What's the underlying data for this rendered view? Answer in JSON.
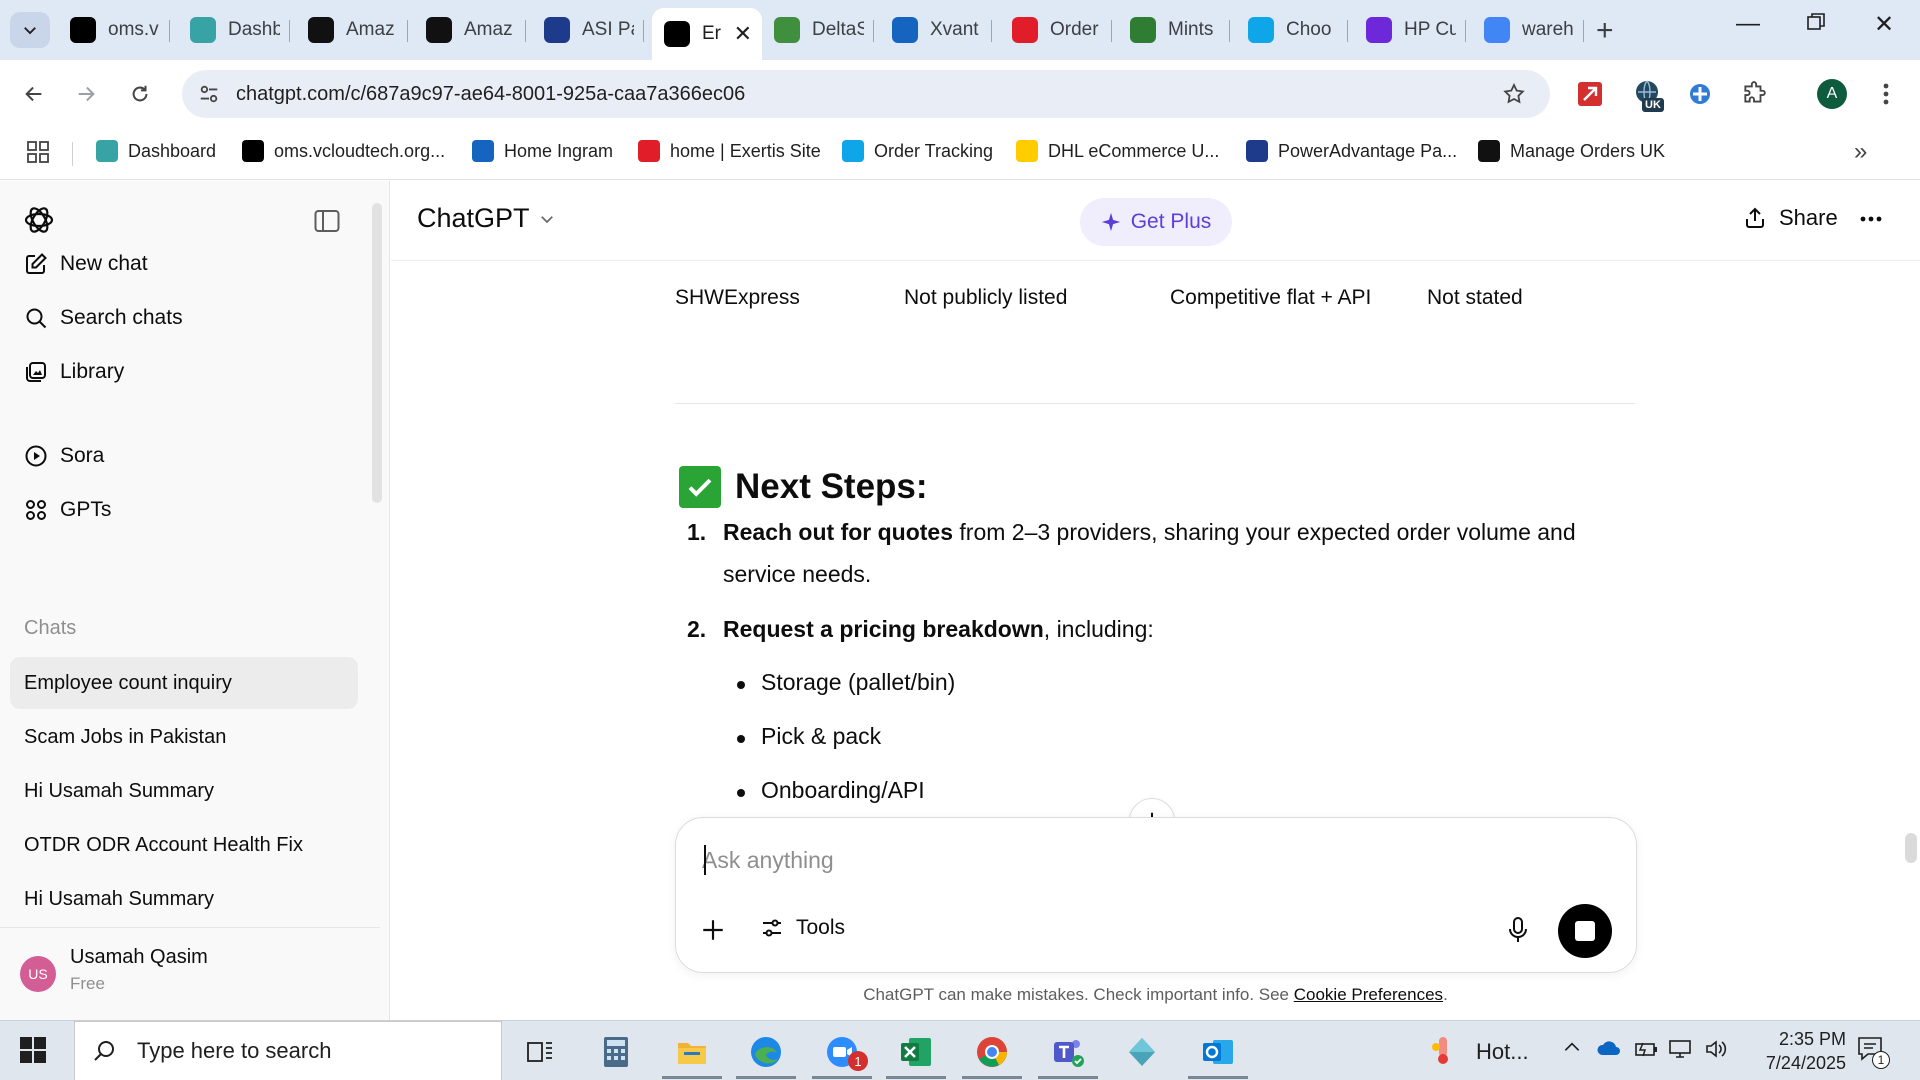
{
  "browser": {
    "tabs": [
      {
        "label": "oms.v",
        "icon": "vcloud-icon",
        "color": "#000000"
      },
      {
        "label": "Dashb",
        "icon": "dashboard-icon",
        "color": "#38a3a5"
      },
      {
        "label": "Amaz",
        "icon": "amazon-icon",
        "color": "#111111"
      },
      {
        "label": "Amaz",
        "icon": "amazon-icon",
        "color": "#111111"
      },
      {
        "label": "ASI Pa",
        "icon": "asi-icon",
        "color": "#1e3a8a"
      },
      {
        "label": "Er",
        "icon": "chatgpt-icon",
        "color": "#000000",
        "active": true
      },
      {
        "label": "DeltaS",
        "icon": "delta-icon",
        "color": "#3f8f3f"
      },
      {
        "label": "Xvant",
        "icon": "xvantage-icon",
        "color": "#1565c0"
      },
      {
        "label": "Order",
        "icon": "exertis-icon",
        "color": "#e11d2a"
      },
      {
        "label": "Mints",
        "icon": "mints-icon",
        "color": "#2e7d32"
      },
      {
        "label": "Choo",
        "icon": "choose-icon",
        "color": "#0ea5e9"
      },
      {
        "label": "HP Cu",
        "icon": "hp-icon",
        "color": "#6d28d9"
      },
      {
        "label": "wareh",
        "icon": "google-icon",
        "color": "#4285f4"
      }
    ],
    "url": "chatgpt.com/c/687a9c97-ae64-8001-925a-caa7a366ec06",
    "profile_initial": "A",
    "ext_badge": "UK",
    "bookmarks": [
      {
        "label": "Dashboard",
        "color": "#38a3a5"
      },
      {
        "label": "oms.vcloudtech.org...",
        "color": "#000000"
      },
      {
        "label": "Home Ingram",
        "color": "#1565c0"
      },
      {
        "label": "home | Exertis Site",
        "color": "#e11d2a"
      },
      {
        "label": "Order Tracking",
        "color": "#0ea5e9"
      },
      {
        "label": "DHL eCommerce U...",
        "color": "#ffcc00"
      },
      {
        "label": "PowerAdvantage Pa...",
        "color": "#1e3a8a"
      },
      {
        "label": "Manage Orders UK",
        "color": "#111111"
      }
    ]
  },
  "sidebar": {
    "new_chat": "New chat",
    "search_chats": "Search chats",
    "library": "Library",
    "sora": "Sora",
    "gpts": "GPTs",
    "chats_heading": "Chats",
    "chats": [
      "Employee count inquiry",
      "Scam Jobs in Pakistan",
      "Hi Usamah Summary",
      "OTDR ODR Account Health Fix",
      "Hi Usamah Summary"
    ],
    "user": {
      "initials": "US",
      "name": "Usamah Qasim",
      "plan": "Free"
    }
  },
  "header": {
    "model": "ChatGPT",
    "get_plus": "Get Plus",
    "share": "Share"
  },
  "message": {
    "table_row": [
      "SHWExpress",
      "Not publicly listed",
      "Competitive flat + API",
      "Not stated"
    ],
    "heading": "Next Steps:",
    "steps": [
      {
        "num": "1.",
        "bold": "Reach out for quotes",
        "rest": " from 2–3 providers, sharing your expected order volume and service needs."
      },
      {
        "num": "2.",
        "bold": "Request a pricing breakdown",
        "rest": ", including:"
      }
    ],
    "bullets": [
      "Storage (pallet/bin)",
      "Pick & pack",
      "Onboarding/API"
    ]
  },
  "composer": {
    "placeholder": "Ask anything",
    "tools": "Tools"
  },
  "disclaimer": {
    "text": "ChatGPT can make mistakes. Check important info. See ",
    "link": "Cookie Preferences",
    "end": "."
  },
  "taskbar": {
    "search_placeholder": "Type here to search",
    "weather": "Hot...",
    "time": "2:35 PM",
    "date": "7/24/2025",
    "zoom_badge": "1",
    "notif_badge": "1"
  }
}
